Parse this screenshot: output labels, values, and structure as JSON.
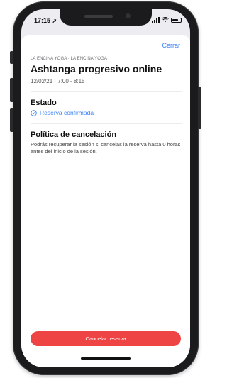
{
  "status_bar": {
    "time": "17:15",
    "location_glyph": "➚"
  },
  "header": {
    "close_label": "Cerrar"
  },
  "session": {
    "kicker": "LA ENCINA YOGA · LA ENCINA YOGA",
    "title": "Ashtanga progresivo online",
    "datetime": "12/02/21 · 7:00 - 8:15"
  },
  "estado": {
    "heading": "Estado",
    "status": "Reserva confirmada",
    "status_color": "#3b82f6"
  },
  "politica": {
    "heading": "Política de cancelación",
    "text": "Podrás recuperar la sesión si cancelas la reserva hasta 0 horas antes del inicio de la sesión."
  },
  "actions": {
    "cancel_label": "Cancelar reserva",
    "cancel_color": "#ef4444"
  },
  "icons": {
    "status_icon": "check-circle-icon",
    "signal_icon": "signal-icon",
    "wifi_icon": "wifi-icon",
    "battery_icon": "battery-icon"
  }
}
